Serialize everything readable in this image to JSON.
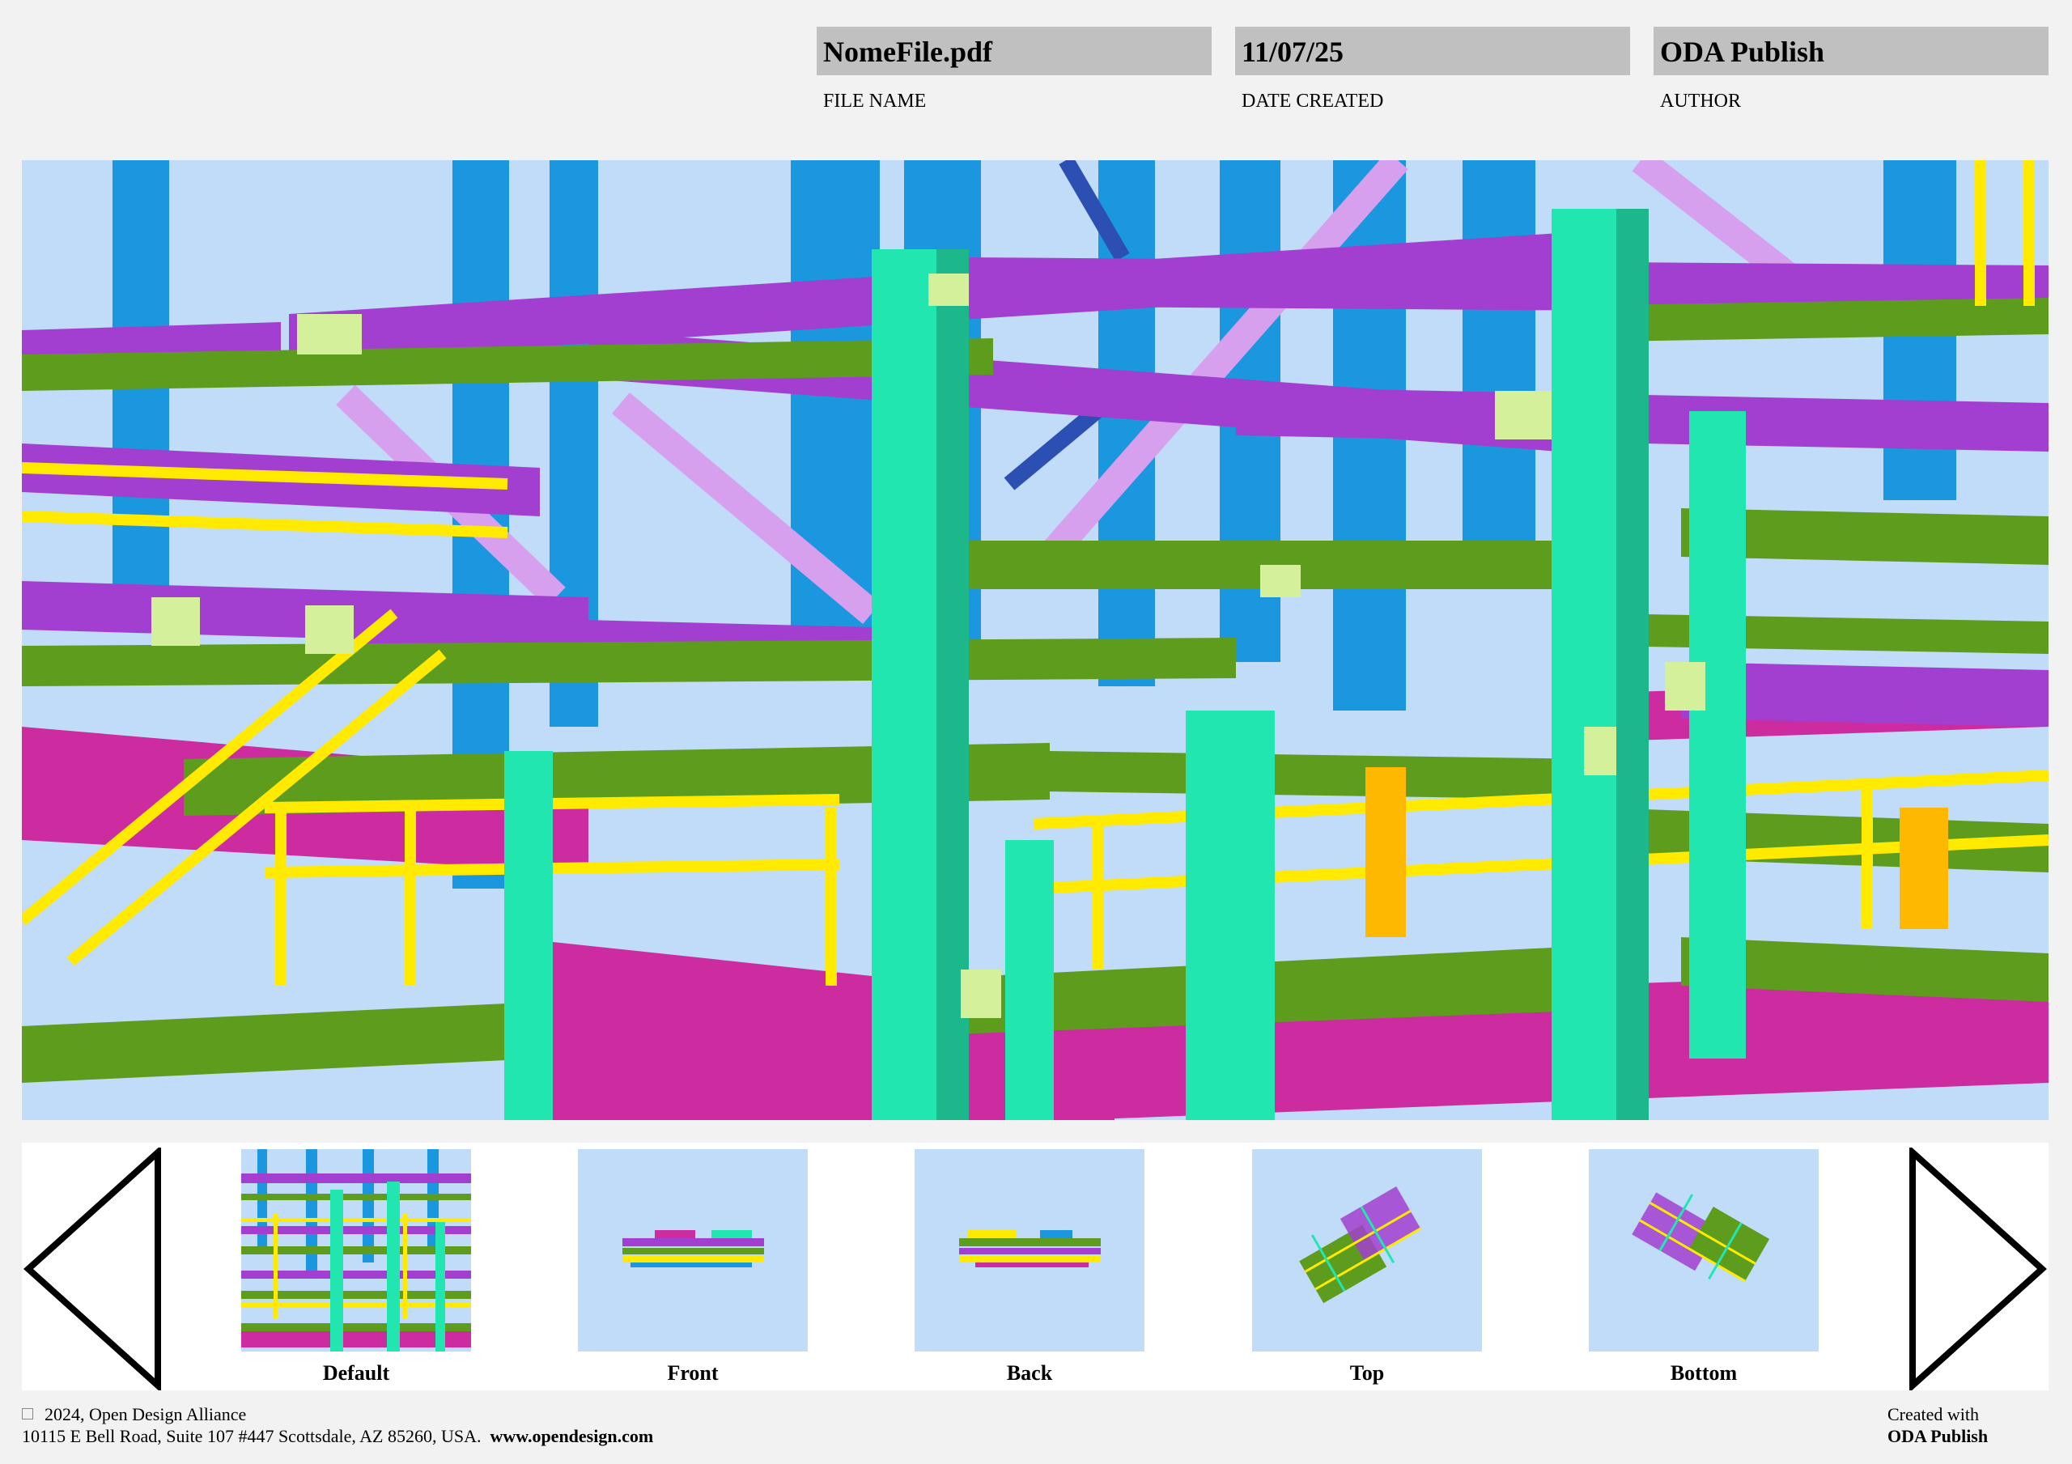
{
  "header": {
    "fields": [
      {
        "value": "NomeFile.pdf",
        "label": "FILE NAME"
      },
      {
        "value": "11/07/25",
        "label": "DATE CREATED"
      },
      {
        "value": "ODA Publish",
        "label": "AUTHOR"
      }
    ]
  },
  "colors": {
    "viewport_background": "#c0dcf8",
    "column_blue": "#1b97e0",
    "column_teal": "#22e6b0",
    "beam_purple": "#a23fd0",
    "beam_green": "#5e9c1e",
    "railing_yellow": "#ffea00",
    "slab_magenta": "#cc2ca0",
    "brace_lilac": "#d7a0ee"
  },
  "navigation": {
    "prev_icon": "triangle-left-icon",
    "next_icon": "triangle-right-icon",
    "views": [
      {
        "label": "Default"
      },
      {
        "label": "Front"
      },
      {
        "label": "Back"
      },
      {
        "label": "Top"
      },
      {
        "label": "Bottom"
      }
    ]
  },
  "footer": {
    "copyright": "2024, Open Design Alliance",
    "address": "10115 E Bell Road, Suite 107 #447 Scottsdale, AZ 85260, USA.",
    "website": "www.opendesign.com",
    "created_with": "Created with",
    "product": "ODA Publish"
  }
}
